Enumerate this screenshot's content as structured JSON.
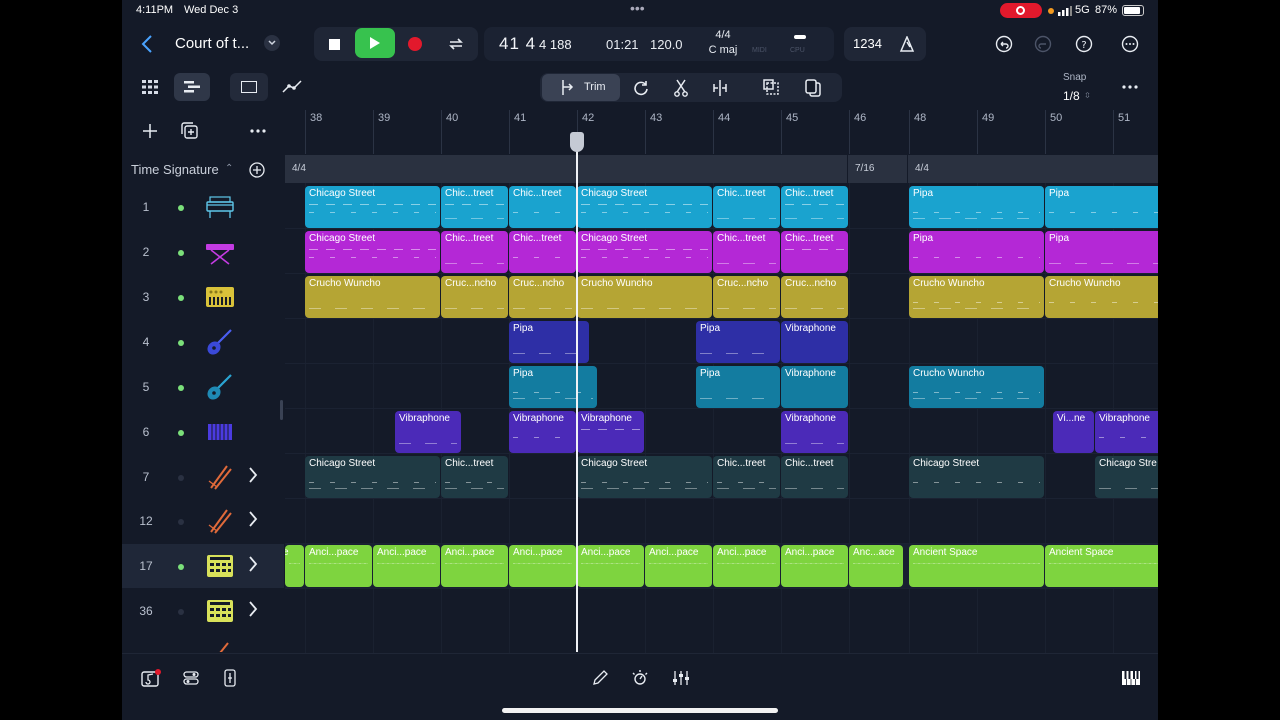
{
  "status": {
    "time": "4:11PM",
    "date": "Wed Dec 3",
    "dots": "•••",
    "signal": "5G",
    "battery": "87%"
  },
  "project": {
    "title": "Court of t..."
  },
  "transport": {
    "position_bars": "41",
    "position_beat": "4",
    "position_sub": "4",
    "position_ticks": "188",
    "time": "01:21",
    "tempo": "120.0",
    "signature": "4/4",
    "key": "C maj",
    "midi_label": "MIDI",
    "cpu_label": "CPU",
    "count_in": "1234"
  },
  "toolbar": {
    "trim_label": "Trim",
    "snap_label": "Snap",
    "snap_value": "1/8"
  },
  "header": {
    "time_signature_label": "Time Signature"
  },
  "ruler": {
    "bars": [
      "38",
      "39",
      "40",
      "41",
      "42",
      "43",
      "44",
      "45",
      "46",
      "48",
      "49",
      "50",
      "51"
    ]
  },
  "signatures": [
    "4/4",
    "7/16",
    "4/4"
  ],
  "tracks": [
    {
      "num": "1",
      "icon": "keyboard-icon",
      "active": true,
      "chevron": false
    },
    {
      "num": "2",
      "icon": "synth-keyboard-icon",
      "active": true,
      "chevron": false
    },
    {
      "num": "3",
      "icon": "synth-icon",
      "active": true,
      "chevron": false
    },
    {
      "num": "4",
      "icon": "guitar-icon",
      "active": true,
      "chevron": false
    },
    {
      "num": "5",
      "icon": "guitar-icon",
      "active": true,
      "chevron": false
    },
    {
      "num": "6",
      "icon": "vibraphone-icon",
      "active": true,
      "chevron": false
    },
    {
      "num": "7",
      "icon": "drumsticks-icon",
      "active": false,
      "chevron": true
    },
    {
      "num": "12",
      "icon": "drumsticks-icon",
      "active": false,
      "chevron": true
    },
    {
      "num": "17",
      "icon": "drum-machine-icon",
      "active": true,
      "chevron": true
    },
    {
      "num": "36",
      "icon": "drum-machine-icon",
      "active": false,
      "chevron": true
    }
  ],
  "regions": {
    "lane1": [
      "Chicago Street",
      "Chic...treet",
      "Chic...treet",
      "Chicago Street",
      "Chic...treet",
      "Chic...treet",
      "Pipa",
      "Pipa"
    ],
    "lane2": [
      "Chicago Street",
      "Chic...treet",
      "Chic...treet",
      "Chicago Street",
      "Chic...treet",
      "Chic...treet",
      "Pipa",
      "Pipa"
    ],
    "lane3": [
      "Crucho Wuncho",
      "Cruc...ncho",
      "Cruc...ncho",
      "Crucho Wuncho",
      "Cruc...ncho",
      "Cruc...ncho",
      "Crucho Wuncho",
      "Crucho Wuncho"
    ],
    "lane4": [
      "Pipa",
      "Pipa",
      "Vibraphone"
    ],
    "lane5": [
      "Pipa",
      "Pipa",
      "Vibraphone",
      "Crucho Wuncho"
    ],
    "lane6": [
      "Vibraphone",
      "Vibraphone",
      "Vibraphone",
      "Vibraphone",
      "Vi...ne",
      "Vibraphone"
    ],
    "lane7": [
      "Chicago Street",
      "Chic...treet",
      "Chicago Street",
      "Chic...treet",
      "Chic...treet",
      "Chicago Street",
      "Chicago Stre"
    ],
    "lane17": [
      "Anci...pace",
      "Anci...pace",
      "Anci...pace",
      "Anci...pace",
      "Anci...pace",
      "Anci...pace",
      "Anci...pace",
      "Anci...pace",
      "Anc...ace",
      "Ancient Space",
      "Ancient Space"
    ]
  },
  "colors": {
    "lane1": "#1aa3cf",
    "lane2": "#b428d6",
    "lane3": "#b5a534",
    "lane4": "#2e2fa6",
    "lane5": "#137ca0",
    "lane6": "#4b2ab8",
    "lane7": "#1f3a44",
    "lane17": "#7ed43f",
    "play": "#37c24e",
    "record": "#e2192c"
  }
}
